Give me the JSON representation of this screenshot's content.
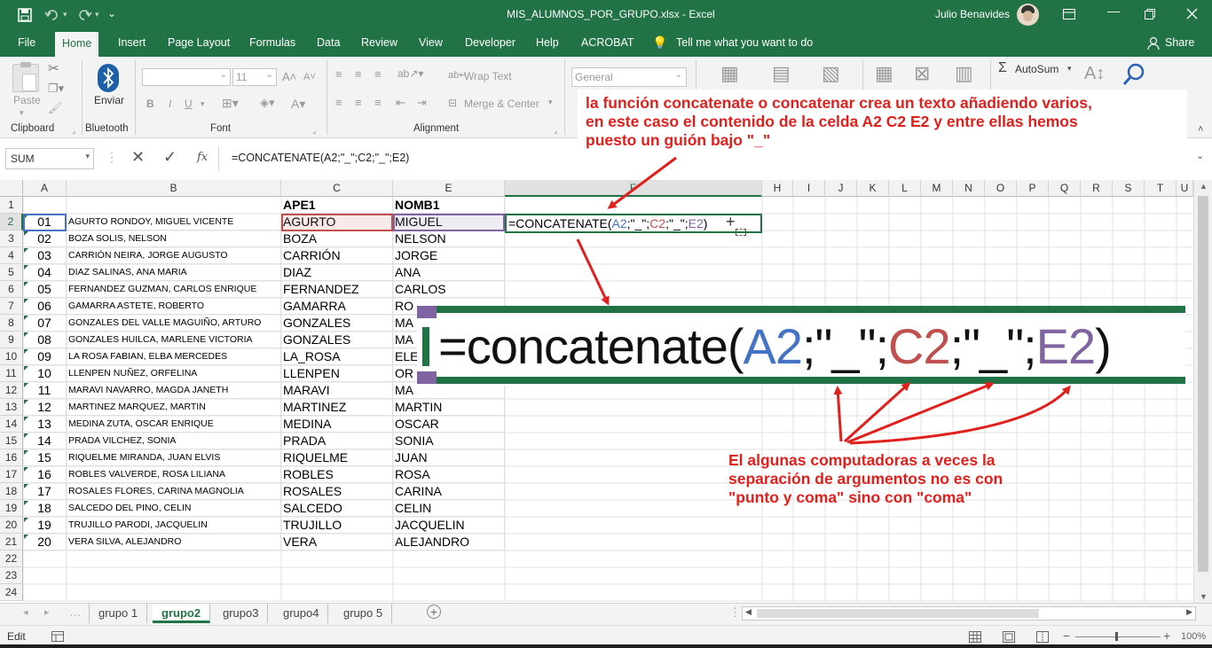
{
  "window": {
    "file_title": "MIS_ALUMNOS_POR_GRUPO.xlsx  -  Excel",
    "user": "Julio Benavides"
  },
  "ribbon_tabs": [
    "File",
    "Home",
    "Insert",
    "Page Layout",
    "Formulas",
    "Data",
    "Review",
    "View",
    "Developer",
    "Help",
    "ACROBAT"
  ],
  "tell_me": "Tell me what you want to do",
  "share": "Share",
  "ribbon": {
    "paste": "Paste",
    "enviar": "Enviar",
    "font_size": "11",
    "wrap_text": "Wrap Text",
    "merge_center": "Merge & Center",
    "number_format": "General",
    "autosum": "AutoSum",
    "groups": {
      "clipboard": "Clipboard",
      "bluetooth": "Bluetooth",
      "font": "Font",
      "alignment": "Alignment"
    }
  },
  "formula_bar": {
    "name_box": "SUM",
    "fx": "fx",
    "formula": "=CONCATENATE(A2;\"_\";C2;\"_\";E2)"
  },
  "columns": [
    "A",
    "B",
    "C",
    "D",
    "E",
    "F",
    "G",
    "H",
    "I",
    "J",
    "K",
    "L",
    "M",
    "N",
    "O",
    "P",
    "Q",
    "R",
    "S",
    "T",
    "U"
  ],
  "rows": [
    "1",
    "2",
    "3",
    "4",
    "5",
    "6",
    "7",
    "8",
    "9",
    "10",
    "11",
    "12",
    "13",
    "14",
    "15",
    "16",
    "17",
    "18",
    "19",
    "20",
    "21",
    "22",
    "23",
    "24"
  ],
  "headers": {
    "c": "APE1",
    "e": "NOMB1"
  },
  "students": [
    {
      "n": "01",
      "full": "AGURTO RONDOY, MIGUEL VICENTE",
      "ape": "AGURTO",
      "nom": "MIGUEL"
    },
    {
      "n": "02",
      "full": "BOZA SOLIS, NELSON",
      "ape": "BOZA",
      "nom": "NELSON"
    },
    {
      "n": "03",
      "full": "CARRIÓN NEIRA, JORGE AUGUSTO",
      "ape": "CARRIÓN",
      "nom": "JORGE"
    },
    {
      "n": "04",
      "full": "DIAZ SALINAS, ANA MARIA",
      "ape": "DIAZ",
      "nom": "ANA"
    },
    {
      "n": "05",
      "full": "FERNANDEZ GUZMAN, CARLOS ENRIQUE",
      "ape": "FERNANDEZ",
      "nom": "CARLOS"
    },
    {
      "n": "06",
      "full": "GAMARRA ASTETE, ROBERTO",
      "ape": "GAMARRA",
      "nom": "RO"
    },
    {
      "n": "07",
      "full": "GONZALES DEL VALLE MAGUIÑO, ARTURO",
      "ape": "GONZALES",
      "nom": "MA"
    },
    {
      "n": "08",
      "full": "GONZALES HUILCA, MARLENE VICTORIA",
      "ape": "GONZALES",
      "nom": "MA"
    },
    {
      "n": "09",
      "full": "LA ROSA FABIAN, ELBA MERCEDES",
      "ape": "LA_ROSA",
      "nom": "ELE"
    },
    {
      "n": "10",
      "full": "LLENPEN NUÑEZ, ORFELINA",
      "ape": "LLENPEN",
      "nom": "OR"
    },
    {
      "n": "11",
      "full": "MARAVI NAVARRO, MAGDA JANETH",
      "ape": "MARAVI",
      "nom": "MA"
    },
    {
      "n": "12",
      "full": "MARTINEZ MARQUEZ, MARTIN",
      "ape": "MARTINEZ",
      "nom": "MARTIN"
    },
    {
      "n": "13",
      "full": "MEDINA ZUTA, OSCAR ENRIQUE",
      "ape": "MEDINA",
      "nom": "OSCAR"
    },
    {
      "n": "14",
      "full": "PRADA VILCHEZ, SONIA",
      "ape": "PRADA",
      "nom": "SONIA"
    },
    {
      "n": "15",
      "full": "RIQUELME MIRANDA, JUAN ELVIS",
      "ape": "RIQUELME",
      "nom": "JUAN"
    },
    {
      "n": "16",
      "full": "ROBLES VALVERDE, ROSA LILIANA",
      "ape": "ROBLES",
      "nom": "ROSA"
    },
    {
      "n": "17",
      "full": "ROSALES FLORES, CARINA MAGNOLIA",
      "ape": "ROSALES",
      "nom": "CARINA"
    },
    {
      "n": "18",
      "full": "SALCEDO DEL PINO, CELIN",
      "ape": "SALCEDO",
      "nom": "CELIN"
    },
    {
      "n": "19",
      "full": "TRUJILLO PARODI, JACQUELIN",
      "ape": "TRUJILLO",
      "nom": "JACQUELIN"
    },
    {
      "n": "20",
      "full": "VERA SILVA, ALEJANDRO",
      "ape": "VERA",
      "nom": "ALEJANDRO"
    }
  ],
  "edit_cell": {
    "p1": "=CONCATENATE(",
    "a2": "A2",
    "s1": ";\"_\";",
    "c2": "C2",
    "s2": ";\"_\";",
    "e2": "E2",
    "p2": ")"
  },
  "zoom_formula": {
    "p1": "=concatenate(",
    "a2": "A2",
    "s1": ";\"_\";",
    "c2": "C2",
    "s2": ";\"_\";",
    "e2": "E2",
    "p2": ")"
  },
  "annotations": {
    "top": [
      "la función concatenate  o concatenar crea un texto añadiendo varios,",
      "en este caso el contenido de la celda A2 C2 E2 y entre ellas hemos",
      "puesto un guión bajo \"_\""
    ],
    "bottom": [
      "El algunas computadoras a veces la",
      "separación de argumentos no es con",
      "\"punto y coma\" sino con \"coma\""
    ]
  },
  "sheet_tabs": [
    "grupo 1",
    "grupo2",
    "grupo3",
    "grupo4",
    "grupo 5"
  ],
  "active_sheet": "grupo2",
  "status": {
    "mode": "Edit",
    "zoom": "100%"
  },
  "colors": {
    "excel_green": "#217346",
    "ref_blue": "#4472c4",
    "ref_red": "#c0504d",
    "ref_purple": "#8064a2",
    "annotation_red": "#e0201d"
  }
}
